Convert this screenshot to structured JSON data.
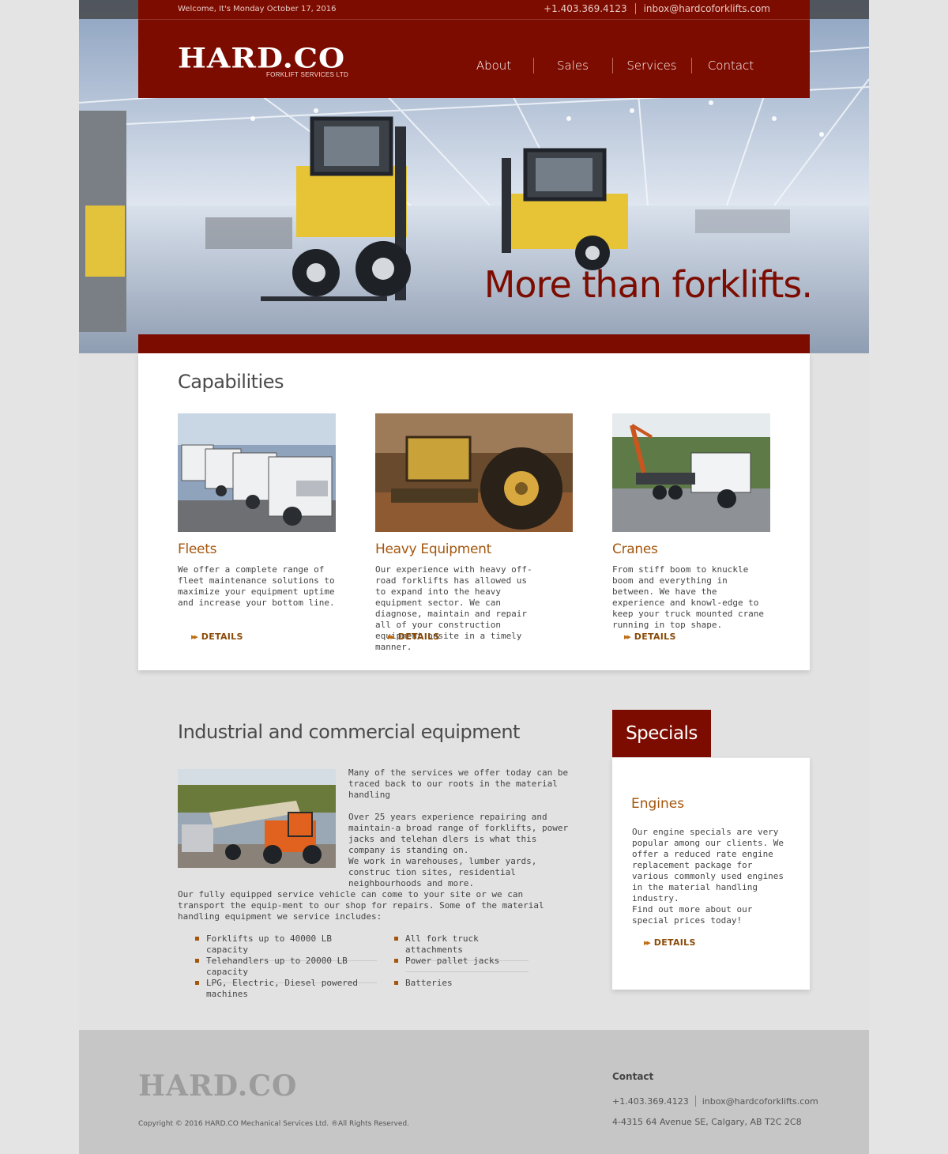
{
  "topbar": {
    "welcome": "Welcome, It's Monday October 17, 2016",
    "phone": "+1.403.369.4123",
    "email": "inbox@hardcoforklifts.com"
  },
  "logo": {
    "name": "HARD.CO",
    "subtitle": "FORKLIFT SERVICES LTD"
  },
  "nav": {
    "items": [
      {
        "label": "About"
      },
      {
        "label": "Sales"
      },
      {
        "label": "Services"
      },
      {
        "label": "Contact"
      }
    ]
  },
  "hero": {
    "tagline": "More than forklifts."
  },
  "capabilities": {
    "title": "Capabilities",
    "items": [
      {
        "title": "Fleets",
        "text": "We offer a complete range of fleet maintenance solutions to maximize your equipment uptime and increase your bottom line.",
        "link": "DETAILS"
      },
      {
        "title": "Heavy Equipment",
        "text": "Our experience with heavy off-road forklifts has allowed us to expand into the heavy equipment sector.  We can diagnose, maintain and repair all of your construction equipment onsite in a timely manner.",
        "link": "DETAILS"
      },
      {
        "title": "Cranes",
        "text": "From stiff boom to knuckle boom and everything in between.  We have the experience and knowl-edge to keep your truck mounted crane running in top shape.",
        "link": "DETAILS"
      }
    ]
  },
  "industrial": {
    "title": "Industrial and commercial equipment",
    "p1": "Many of the services we offer today can be traced back to our roots in the material handling",
    "p2": "Over 25 years experience repairing and maintain-a broad range of forklifts, power jacks and telehan dlers is what this company is standing on.",
    "p3": "We work in warehouses, lumber yards, construc tion sites, residential neighbourhoods and more.",
    "p4": "Our fully equipped service vehicle can come to your site or we can transport the equip-ment to our shop for repairs.  Some of the material handling equipment we service includes:",
    "list_left": [
      "Forklifts up to 40000 LB capacity",
      "Telehandlers up to 20000 LB capacity",
      "LPG, Electric, Diesel powered machines"
    ],
    "list_right": [
      "All fork truck attachments",
      "Power pallet jacks",
      "Batteries"
    ]
  },
  "specials": {
    "tab": "Specials",
    "title": "Engines",
    "p1": "Our engine specials are very popular among our clients.  We offer a reduced rate engine replacement package for various commonly used engines in the material handling industry.",
    "p2": "Find out more about our special prices today!",
    "link": "DETAILS"
  },
  "footer": {
    "logo": "HARD.CO",
    "copyright": "Copyright © 2016 HARD.CO Mechanical Services Ltd.  ®All Rights Reserved.",
    "contact_title": "Contact",
    "phone": "+1.403.369.4123",
    "email": "inbox@hardcoforklifts.com",
    "address": "4-4315 64 Avenue SE, Calgary, AB T2C 2C8"
  },
  "colors": {
    "brand_red": "#7d0c00",
    "accent_orange": "#a4560d",
    "page_bg": "#e4e4e4"
  }
}
